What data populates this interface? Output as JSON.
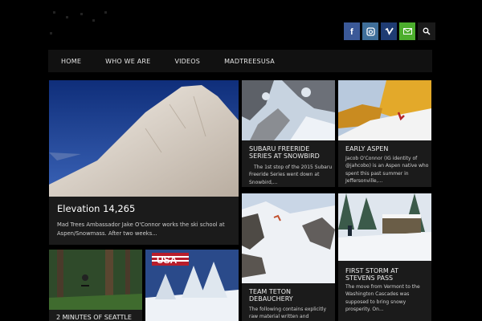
{
  "nav": {
    "items": [
      "HOME",
      "WHO WE ARE",
      "VIDEOS",
      "MADTREESUSA"
    ]
  },
  "social": {
    "icons": [
      "facebook-icon",
      "instagram-icon",
      "vimeo-icon",
      "email-icon",
      "search-icon"
    ],
    "colors": {
      "facebook": "#3b5998",
      "instagram": "#3f6f9a",
      "vimeo": "#1f3c73",
      "email": "#4cae2d",
      "search": "#1a1a1a"
    }
  },
  "posts": {
    "elevation": {
      "title": "Elevation 14,265",
      "excerpt": "Mad Trees Ambassador Jake O'Connor works the ski school at Aspen/Snowmass.  After two weeks..."
    },
    "subaru": {
      "title": "SUBARU FREERIDE SERIES AT SNOWBIRD",
      "excerpt": "The 1st stop of the 2015 Subaru Freeride Series went down at Snowbird,..."
    },
    "aspen": {
      "title": "EARLY ASPEN",
      "excerpt": "Jacob O'Connor (IG identity of @jahcobo) is an Aspen native who spent this past summer in Jeffersonville,..."
    },
    "teton": {
      "title": "TEAM TETON DEBAUCHERY",
      "excerpt": "The following contains explicitly raw material written and"
    },
    "storm": {
      "title": "FIRST STORM AT STEVENS PASS",
      "excerpt": "The move from Vermont to the Washington Cascades was supposed to bring snowy prosperity.  On..."
    },
    "seattle": {
      "title": "2 MINUTES OF SEATTLE"
    },
    "usa": {
      "flag_text": "USA"
    }
  }
}
